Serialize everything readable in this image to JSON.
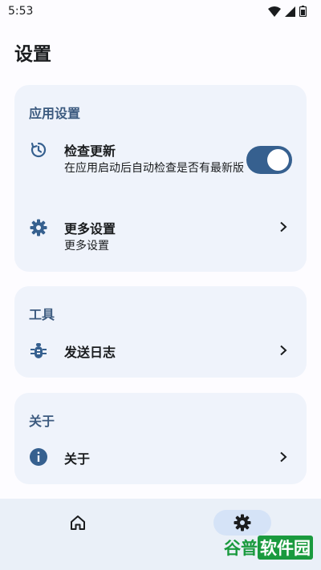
{
  "status_bar": {
    "time": "5:53"
  },
  "page": {
    "title": "设置"
  },
  "sections": {
    "app": {
      "title": "应用设置",
      "check_update": {
        "title": "检查更新",
        "subtitle": "在应用启动后自动检查是否有最新版",
        "enabled": true
      },
      "more_settings": {
        "title": "更多设置",
        "subtitle": "更多设置"
      }
    },
    "tools": {
      "title": "工具",
      "send_log": {
        "title": "发送日志"
      }
    },
    "about": {
      "title": "关于",
      "about_item": {
        "title": "关于"
      }
    }
  },
  "watermark": {
    "part1": "谷普",
    "part2": "软件园"
  },
  "colors": {
    "accent": "#36608f",
    "section_title": "#3c5a7f",
    "card": "#eff3fb",
    "nav_bg": "#eaf0f8",
    "nav_active": "#d5e3f7"
  }
}
